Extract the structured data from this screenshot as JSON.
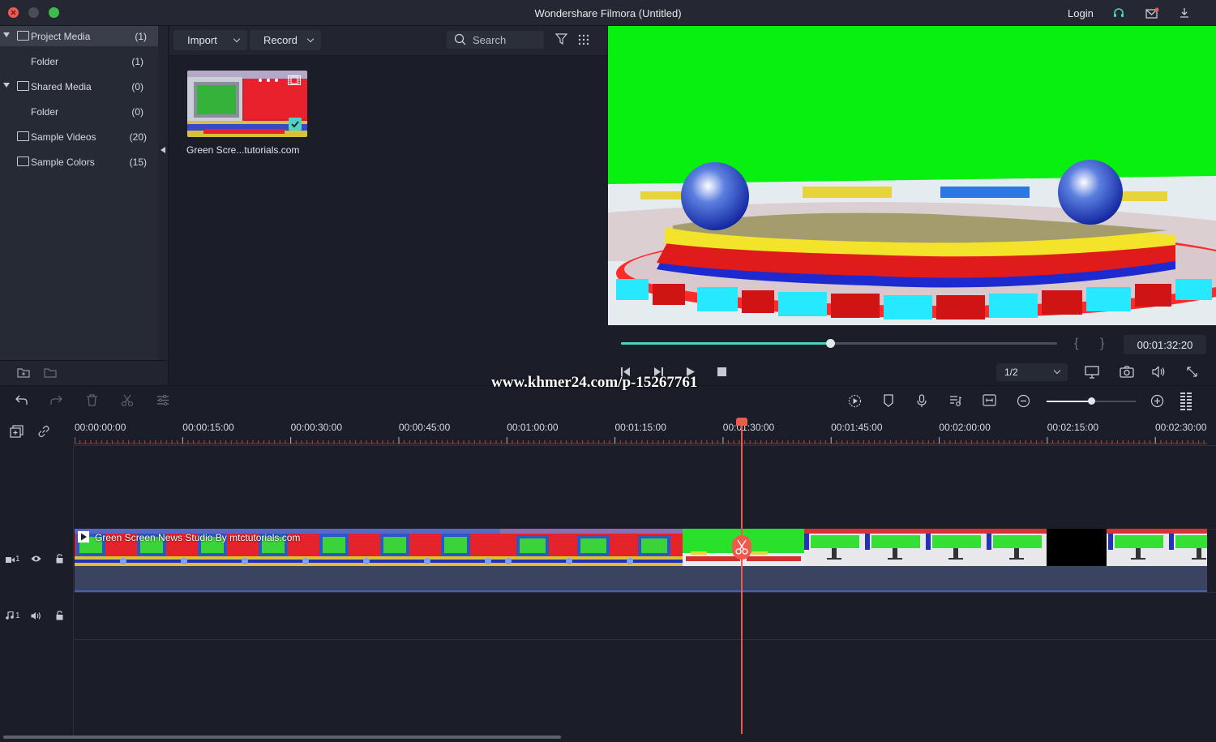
{
  "titlebar": {
    "title": "Wondershare Filmora (Untitled)",
    "login_label": "Login",
    "colors": {
      "close": "#ee5b53",
      "minimize": "#4a4d55",
      "zoom": "#3cbd4d",
      "headset": "#4fd2c2"
    }
  },
  "library": {
    "items": [
      {
        "label": "Project Media",
        "count": "(1)"
      },
      {
        "label": "Folder",
        "count": "(1)"
      },
      {
        "label": "Shared Media",
        "count": "(0)"
      },
      {
        "label": "Folder",
        "count": "(0)"
      },
      {
        "label": "Sample Videos",
        "count": "(20)"
      },
      {
        "label": "Sample Colors",
        "count": "(15)"
      }
    ]
  },
  "media": {
    "import_label": "Import",
    "record_label": "Record",
    "search_placeholder": "Search",
    "clips": [
      {
        "name": "Green Scre...tutorials.com",
        "selected": true
      }
    ]
  },
  "player": {
    "timecode": "00:01:32:20",
    "progress": 0.48,
    "ratio": "1/2",
    "colors": {
      "progress": "#4fd2c2"
    }
  },
  "timeline": {
    "ticks": [
      "00:00:00:00",
      "00:00:15:00",
      "00:00:30:00",
      "00:00:45:00",
      "00:01:00:00",
      "00:01:15:00",
      "00:01:30:00",
      "00:01:45:00",
      "00:02:00:00",
      "00:02:15:00",
      "00:02:30:00"
    ],
    "video_track_label": "1",
    "audio_track_label": "1",
    "clip_title": "Green Screen News Studio By mtctutorials.com",
    "colors": {
      "playhead": "#ef5a4d"
    }
  },
  "watermark": "www.khmer24.com/p-15267761"
}
